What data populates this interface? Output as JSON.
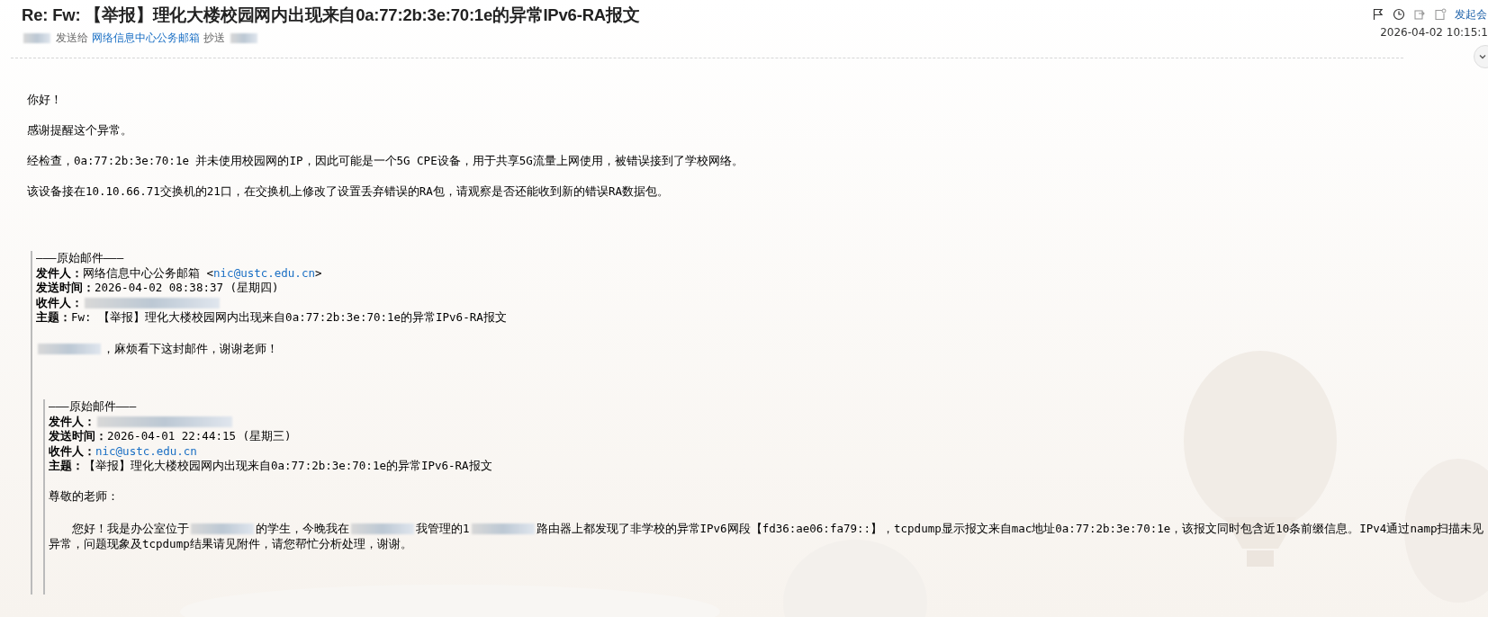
{
  "header": {
    "subject": "Re: Fw: 【举报】理化大楼校园网内出现来自0a:77:2b:3e:70:1e的异常IPv6-RA报文",
    "sender_line": [
      {
        "kind": "redacted"
      },
      {
        "kind": "text",
        "text": "发送给"
      },
      {
        "kind": "link",
        "text": "网络信息中心公务邮箱"
      },
      {
        "kind": "text",
        "text": "抄送"
      },
      {
        "kind": "redacted"
      }
    ]
  },
  "toolbar": {
    "icons": [
      {
        "kind": "flag"
      },
      {
        "kind": "clock"
      },
      {
        "kind": "reply"
      },
      {
        "kind": "note"
      }
    ],
    "link": "发起会",
    "date": "2026-04-02 10:15:1"
  },
  "body": [
    "你好！",
    "感谢提醒这个异常。",
    "经检查，0a:77:2b:3e:70:1e 并未使用校园网的IP，因此可能是一个5G CPE设备，用于共享5G流量上网使用，被错误接到了学校网络。",
    "该设备接在10.10.66.71交换机的21口，在交换机上修改了设置丢弃错误的RA包，请观察是否还能收到新的错误RA数据包。"
  ],
  "quote": {
    "separator": "———原始邮件———",
    "fields": [
      {
        "label": "发件人：",
        "parts": [
          {
            "kind": "text",
            "text": "网络信息中心公务邮箱 <"
          },
          {
            "kind": "link",
            "text": "nic@ustc.edu.cn"
          },
          {
            "kind": "text",
            "text": ">"
          }
        ]
      },
      {
        "label": "发送时间：",
        "parts": [
          {
            "kind": "text",
            "text": "2026-04-02 08:38:37 (星期四)"
          }
        ]
      },
      {
        "label": "收件人：",
        "parts": [
          {
            "kind": "redacted"
          }
        ]
      },
      {
        "label": "主题：",
        "parts": [
          {
            "kind": "text",
            "text": "Fw: 【举报】理化大楼校园网内出现来自0a:77:2b:3e:70:1e的异常IPv6-RA报文"
          }
        ]
      }
    ],
    "lines": [
      {
        "indent": false,
        "parts": [
          {
            "kind": "redacted"
          },
          {
            "kind": "text",
            "text": "，麻烦看下这封邮件，谢谢老师！"
          }
        ]
      }
    ],
    "quote": {
      "separator": "———原始邮件———",
      "fields": [
        {
          "label": "发件人：",
          "parts": [
            {
              "kind": "redacted"
            }
          ]
        },
        {
          "label": "发送时间：",
          "parts": [
            {
              "kind": "text",
              "text": "2026-04-01 22:44:15 (星期三)"
            }
          ]
        },
        {
          "label": "收件人：",
          "parts": [
            {
              "kind": "link",
              "text": "nic@ustc.edu.cn"
            }
          ]
        },
        {
          "label": "主题：",
          "parts": [
            {
              "kind": "text",
              "text": "【举报】理化大楼校园网内出现来自0a:77:2b:3e:70:1e的异常IPv6-RA报文"
            }
          ]
        }
      ],
      "lines": [
        {
          "indent": false,
          "parts": [
            {
              "kind": "text",
              "text": "尊敬的老师："
            }
          ]
        },
        {
          "indent": true,
          "parts": [
            {
              "kind": "text",
              "text": "您好！我是办公室位于"
            },
            {
              "kind": "redacted"
            },
            {
              "kind": "text",
              "text": "的学生，今晚我在"
            },
            {
              "kind": "redacted"
            },
            {
              "kind": "text",
              "text": "我管理的1"
            },
            {
              "kind": "redacted"
            },
            {
              "kind": "text",
              "text": "路由器上都发现了非学校的异常IPv6网段【fd36:ae06:fa79::】，tcpdump显示报文来自mac地址0a:77:2b:3e:70:1e，该报文同时包含近10条前缀信息。IPv4通过namp扫描未见"
            }
          ]
        },
        {
          "indent": false,
          "parts": [
            {
              "kind": "text",
              "text": "异常，问题现象及tcpdump结果请见附件，请您帮忙分析处理，谢谢。"
            }
          ]
        }
      ]
    }
  }
}
